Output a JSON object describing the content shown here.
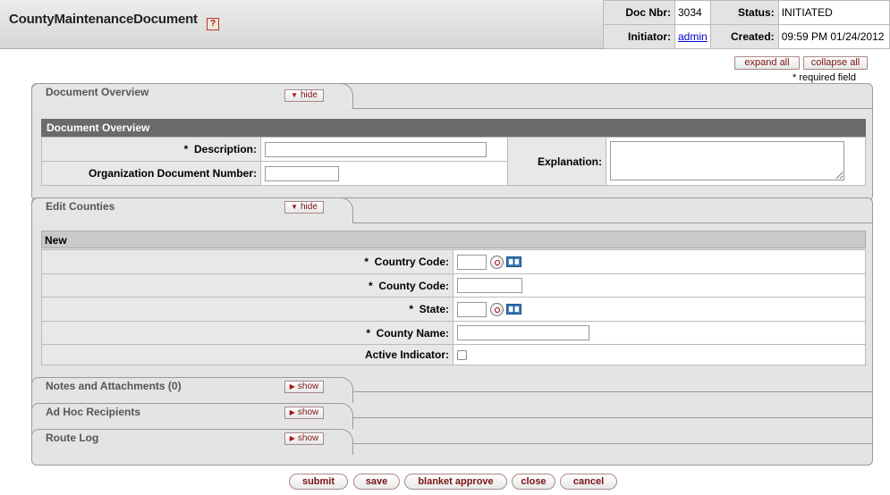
{
  "header": {
    "title": "CountyMaintenanceDocument",
    "help_glyph": "?",
    "doc_nbr_label": "Doc Nbr:",
    "doc_nbr": "3034",
    "status_label": "Status:",
    "status": "INITIATED",
    "initiator_label": "Initiator:",
    "initiator": "admin",
    "created_label": "Created:",
    "created": "09:59 PM 01/24/2012"
  },
  "controls": {
    "expand_all": "expand all",
    "collapse_all": "collapse all",
    "required_note": "* required field"
  },
  "document_overview": {
    "tab_title": "Document Overview",
    "toggle": "hide",
    "section_header": "Document Overview",
    "description_label": "Description:",
    "org_doc_number_label": "Organization Document Number:",
    "explanation_label": "Explanation:",
    "description_value": "",
    "org_doc_number_value": "",
    "explanation_value": ""
  },
  "edit_counties": {
    "tab_title": "Edit Counties",
    "toggle": "hide",
    "section_header": "New",
    "country_code_label": "Country Code:",
    "county_code_label": "County Code:",
    "state_label": "State:",
    "county_name_label": "County Name:",
    "active_indicator_label": "Active Indicator:",
    "country_code_value": "",
    "county_code_value": "",
    "state_value": "",
    "county_name_value": ""
  },
  "collapsed_tabs": [
    {
      "title": "Notes and Attachments (0)",
      "toggle": "show"
    },
    {
      "title": "Ad Hoc Recipients",
      "toggle": "show"
    },
    {
      "title": "Route Log",
      "toggle": "show"
    }
  ],
  "required_marker": "*",
  "actions": {
    "submit": "submit",
    "save": "save",
    "blanket_approve": "blanket approve",
    "close": "close",
    "cancel": "cancel"
  }
}
